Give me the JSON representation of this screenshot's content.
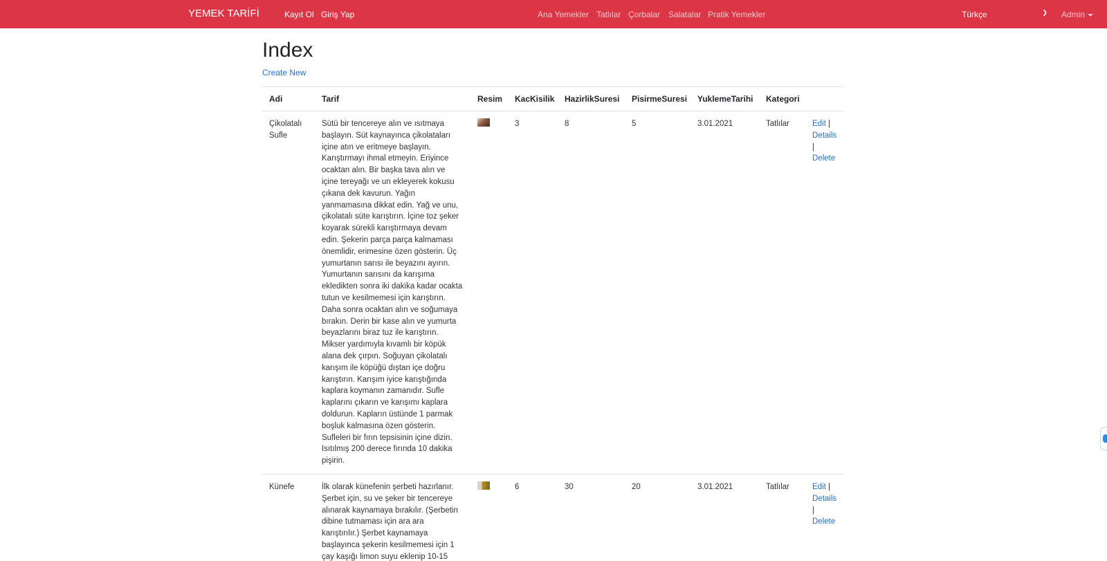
{
  "navbar": {
    "brand": "YEMEK TARİFİ",
    "auth_links": [
      "Kayıt Ol",
      "Giriş Yap"
    ],
    "categories": [
      "Ana Yemekler",
      "Tatlılar",
      "Çorbalar",
      "Salatalar",
      "Pratik Yemekler"
    ],
    "language": "Türkçe",
    "admin": "Admin",
    "colors": {
      "background": "#dc3545"
    }
  },
  "page": {
    "title": "Index",
    "create_new": "Create New"
  },
  "table": {
    "headers": [
      "Adi",
      "Tarif",
      "Resim",
      "KacKisilik",
      "HazirlikSuresi",
      "PisirmeSuresi",
      "YuklemeTarihi",
      "Kategori"
    ],
    "rows": [
      {
        "adi": "Çikolatalı Sufle",
        "tarif": "Sütü bir tencereye alın ve ısıtmaya başlayın. Süt kaynayınca çikolataları içine atın ve eritmeye başlayın. Karıştırmayı ihmal etmeyin. Eriyince ocaktan alın. Bir başka tava alın ve içine tereyağı ve un ekleyerek kokusu çıkana dek kavurun. Yağın yanmamasına dikkat edin. Yağ ve unu, çikolatalı süte karıştırın. İçine toz şeker koyarak sürekli karıştırmaya devam edin. Şekerin parça parça kalmaması önemlidir, erimesine özen gösterin. Üç yumurtanın sarısı ile beyazını ayırın. Yumurtanın sarısını da karışıma ekledikten sonra iki dakika kadar ocakta tutun ve kesilmemesi için karıştırın. Daha sonra ocaktan alın ve soğumaya bırakın. Derin bir kase alın ve yumurta beyazlarını biraz tuz ile karıştırın. Mikser yardımıyla kıvamlı bir köpük alana dek çırpın. Soğuyan çikolatalı karışım ile köpüğü dıştan içe doğru karıştırın. Karışım iyice karıştığında kaplara koymanın zamanıdır. Sufle kaplarını çıkarın ve karışımı kaplara doldurun. Kapların üstünde 1 parmak boşluk kalmasına özen gösterin. Sufleleri bir fırın tepsisinin içine dizin. Isıtılmış 200 derece fırında 10 dakika pişirin.",
        "kac_kisilik": "3",
        "hazirlik_suresi": "8",
        "pisirme_suresi": "5",
        "yukleme_tarihi": "3.01.2021",
        "kategori": "Tatlılar"
      },
      {
        "adi": "Künefe",
        "tarif": "İlk olarak künefenin şerbeti hazırlanır. Şerbet için, su ve şeker bir tencereye alınarak kaynamaya bırakılır. (Şerbetin dibine tutmaması için ara ara karıştırılır.) Şerbet kaynamaya başlayınca şekerin kesilmemesi için 1 çay kaşığı limon suyu eklenip 10-15",
        "kac_kisilik": "6",
        "hazirlik_suresi": "30",
        "pisirme_suresi": "20",
        "yukleme_tarihi": "3.01.2021",
        "kategori": "Tatlılar"
      }
    ],
    "actions": {
      "edit": "Edit",
      "details": "Details",
      "delete": "Delete",
      "separator": "|"
    }
  }
}
